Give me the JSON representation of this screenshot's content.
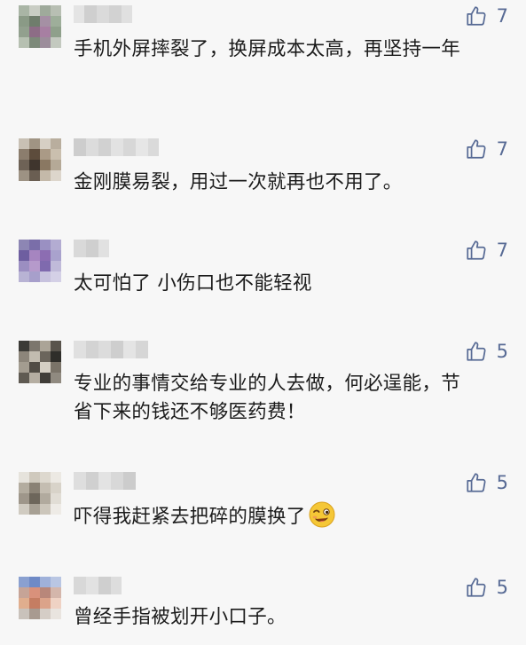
{
  "comments": [
    {
      "name_masked": "",
      "text": "手机外屏摔裂了，换屏成本太高，再坚持一年",
      "likes": "7"
    },
    {
      "name_masked": "",
      "text": "金刚膜易裂，用过一次就再也不用了。",
      "likes": "7"
    },
    {
      "name_masked": "",
      "text": "太可怕了 小伤口也不能轻视",
      "likes": "7"
    },
    {
      "name_masked": "",
      "text": "专业的事情交给专业的人去做，何必逞能，节省下来的钱还不够医药费！",
      "likes": "5"
    },
    {
      "name_masked": "",
      "text": "吓得我赶紧去把碎的膜换了",
      "likes": "5",
      "emoji": "winking-face-emoji"
    },
    {
      "name_masked": "",
      "text": "曾经手指被划开小口子。",
      "likes": "5"
    }
  ],
  "colors": {
    "background": "#f7f7f7",
    "like_icon": "#586b95",
    "text": "#1b1b1b"
  },
  "icons": {
    "like": "thumbs-up-icon"
  }
}
